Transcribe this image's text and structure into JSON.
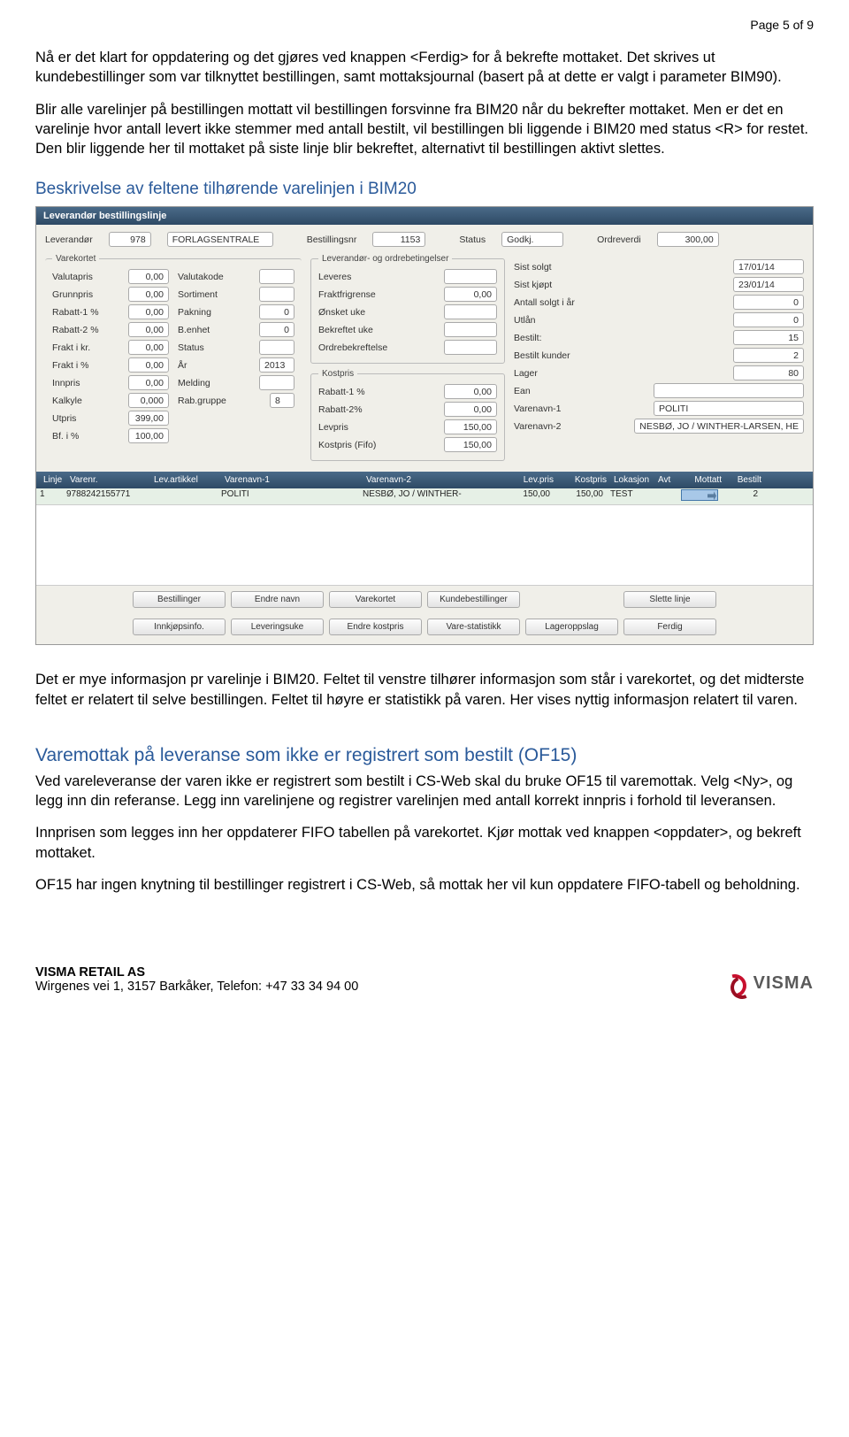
{
  "page_header": "Page 5 of 9",
  "para1": "Nå er det klart for oppdatering og det gjøres ved knappen <Ferdig> for å bekrefte mottaket. Det skrives ut kundebestillinger som var tilknyttet bestillingen, samt mottaksjournal (basert på at dette er valgt i parameter BIM90).",
  "para2": "Blir alle varelinjer på bestillingen mottatt vil bestillingen forsvinne fra BIM20 når du bekrefter mottaket. Men er det en varelinje hvor antall levert ikke stemmer med antall bestilt, vil bestillingen bli liggende i BIM20 med status <R> for restet. Den blir liggende her til mottaket på siste linje blir bekreftet, alternativt til bestillingen aktivt slettes.",
  "section1_title": "Beskrivelse av feltene tilhørende varelinjen i BIM20",
  "app": {
    "titlebar": "Leverandør bestillingslinje",
    "top": {
      "leverandor_lbl": "Leverandør",
      "leverandor_code": "978",
      "leverandor_name": "FORLAGSENTRALE",
      "bestillingsnr_lbl": "Bestillingsnr",
      "bestillingsnr": "1153",
      "status_lbl": "Status",
      "status": "Godkj.",
      "ordreverdi_lbl": "Ordreverdi",
      "ordreverdi": "300,00"
    },
    "varekortet": {
      "legend": "Varekortet",
      "valutapris_lbl": "Valutapris",
      "valutapris": "0,00",
      "grunnpris_lbl": "Grunnpris",
      "grunnpris": "0,00",
      "rabatt1_lbl": "Rabatt-1 %",
      "rabatt1": "0,00",
      "rabatt2_lbl": "Rabatt-2 %",
      "rabatt2": "0,00",
      "fraktkr_lbl": "Frakt i kr.",
      "fraktkr": "0,00",
      "fraktpct_lbl": "Frakt i %",
      "fraktpct": "0,00",
      "innpris_lbl": "Innpris",
      "innpris": "0,00",
      "kalkyle_lbl": "Kalkyle",
      "kalkyle": "0,000",
      "utpris_lbl": "Utpris",
      "utpris": "399,00",
      "bf_lbl": "Bf. i %",
      "bf": "100,00",
      "valutakode_lbl": "Valutakode",
      "valutakode": "",
      "sortiment_lbl": "Sortiment",
      "sortiment": "",
      "pakning_lbl": "Pakning",
      "pakning": "0",
      "benhet_lbl": "B.enhet",
      "benhet": "0",
      "status2_lbl": "Status",
      "status2": "",
      "ar_lbl": "År",
      "ar": "2013",
      "melding_lbl": "Melding",
      "melding": "",
      "rab_gruppe_lbl": "Rab.gruppe",
      "rab_gruppe": "8"
    },
    "levord": {
      "legend": "Leverandør- og ordrebetingelser",
      "leveres_lbl": "Leveres",
      "leveres": "",
      "fraktfri_lbl": "Fraktfrigrense",
      "fraktfri": "0,00",
      "onsket_uke_lbl": "Ønsket uke",
      "onsket_uke": "",
      "bekreftet_uke_lbl": "Bekreftet uke",
      "bekreftet_uke": "",
      "ordrebekr_lbl": "Ordrebekreftelse",
      "ordrebekr": ""
    },
    "kostpris": {
      "legend": "Kostpris",
      "rabatt1_lbl": "Rabatt-1 %",
      "rabatt1": "0,00",
      "rabatt2_lbl": "Rabatt-2%",
      "rabatt2": "0,00",
      "levpris_lbl": "Levpris",
      "levpris": "150,00",
      "kostpris_lbl": "Kostpris (Fifo)",
      "kostpris": "150,00"
    },
    "stats": {
      "sist_solgt_lbl": "Sist solgt",
      "sist_solgt": "17/01/14",
      "sist_kjopt_lbl": "Sist kjøpt",
      "sist_kjopt": "23/01/14",
      "antall_solgt_lbl": "Antall solgt i år",
      "antall_solgt": "0",
      "utlan_lbl": "Utlån",
      "utlan": "0",
      "bestilt_lbl": "Bestilt:",
      "bestilt": "15",
      "bestilt_kunder_lbl": "Bestilt kunder",
      "bestilt_kunder": "2",
      "lager_lbl": "Lager",
      "lager": "80",
      "ean_lbl": "Ean",
      "ean": "",
      "vn1_lbl": "Varenavn-1",
      "vn1": "POLITI",
      "vn2_lbl": "Varenavn-2",
      "vn2": "NESBØ, JO / WINTHER-LARSEN, HE"
    },
    "grid": {
      "headers": {
        "linje": "Linje",
        "varenr": "Varenr.",
        "levart": "Lev.artikkel",
        "vn1": "Varenavn-1",
        "vn2": "Varenavn-2",
        "levpris": "Lev.pris",
        "kostpris": "Kostpris",
        "lokasjon": "Lokasjon",
        "avt": "Avt",
        "mottatt": "Mottatt",
        "bestilt": "Bestilt"
      },
      "row": {
        "linje": "1",
        "varenr": "9788242155771",
        "levart": "",
        "vn1": "POLITI",
        "vn2": "NESBØ, JO / WINTHER-",
        "levpris": "150,00",
        "kostpris": "150,00",
        "lokasjon": "TEST",
        "avt": "",
        "bestilt": "2"
      }
    },
    "buttons_row1": [
      "Bestillinger",
      "Endre navn",
      "Varekortet",
      "Kundebestillinger",
      "",
      "Slette linje"
    ],
    "buttons_row2": [
      "Innkjøpsinfo.",
      "Leveringsuke",
      "Endre kostpris",
      "Vare-statistikk",
      "Lageroppslag",
      "Ferdig"
    ]
  },
  "para3": "Det er mye informasjon pr varelinje i BIM20. Feltet til venstre tilhører informasjon som står i varekortet, og det midterste feltet er relatert til selve bestillingen. Feltet til høyre er statistikk på varen. Her vises nyttig informasjon relatert til varen.",
  "section2_title": "Varemottak på leveranse som ikke er registrert som bestilt (OF15)",
  "para4": "Ved vareleveranse der varen ikke er registrert som bestilt i CS-Web skal du bruke OF15 til varemottak. Velg <Ny>, og legg inn din referanse. Legg inn varelinjene og registrer varelinjen med antall korrekt innpris i forhold til leveransen.",
  "para5": "Innprisen som legges inn her oppdaterer FIFO tabellen på varekortet. Kjør mottak ved knappen <oppdater>, og bekreft mottaket.",
  "para6": "OF15 har ingen knytning til bestillinger registrert i CS-Web, så mottak her vil kun oppdatere FIFO-tabell og beholdning.",
  "footer": {
    "company": "VISMA RETAIL AS",
    "address": "Wirgenes vei 1, 3157 Barkåker, Telefon: +47 33 34 94 00",
    "logo_text": "VISMA"
  }
}
